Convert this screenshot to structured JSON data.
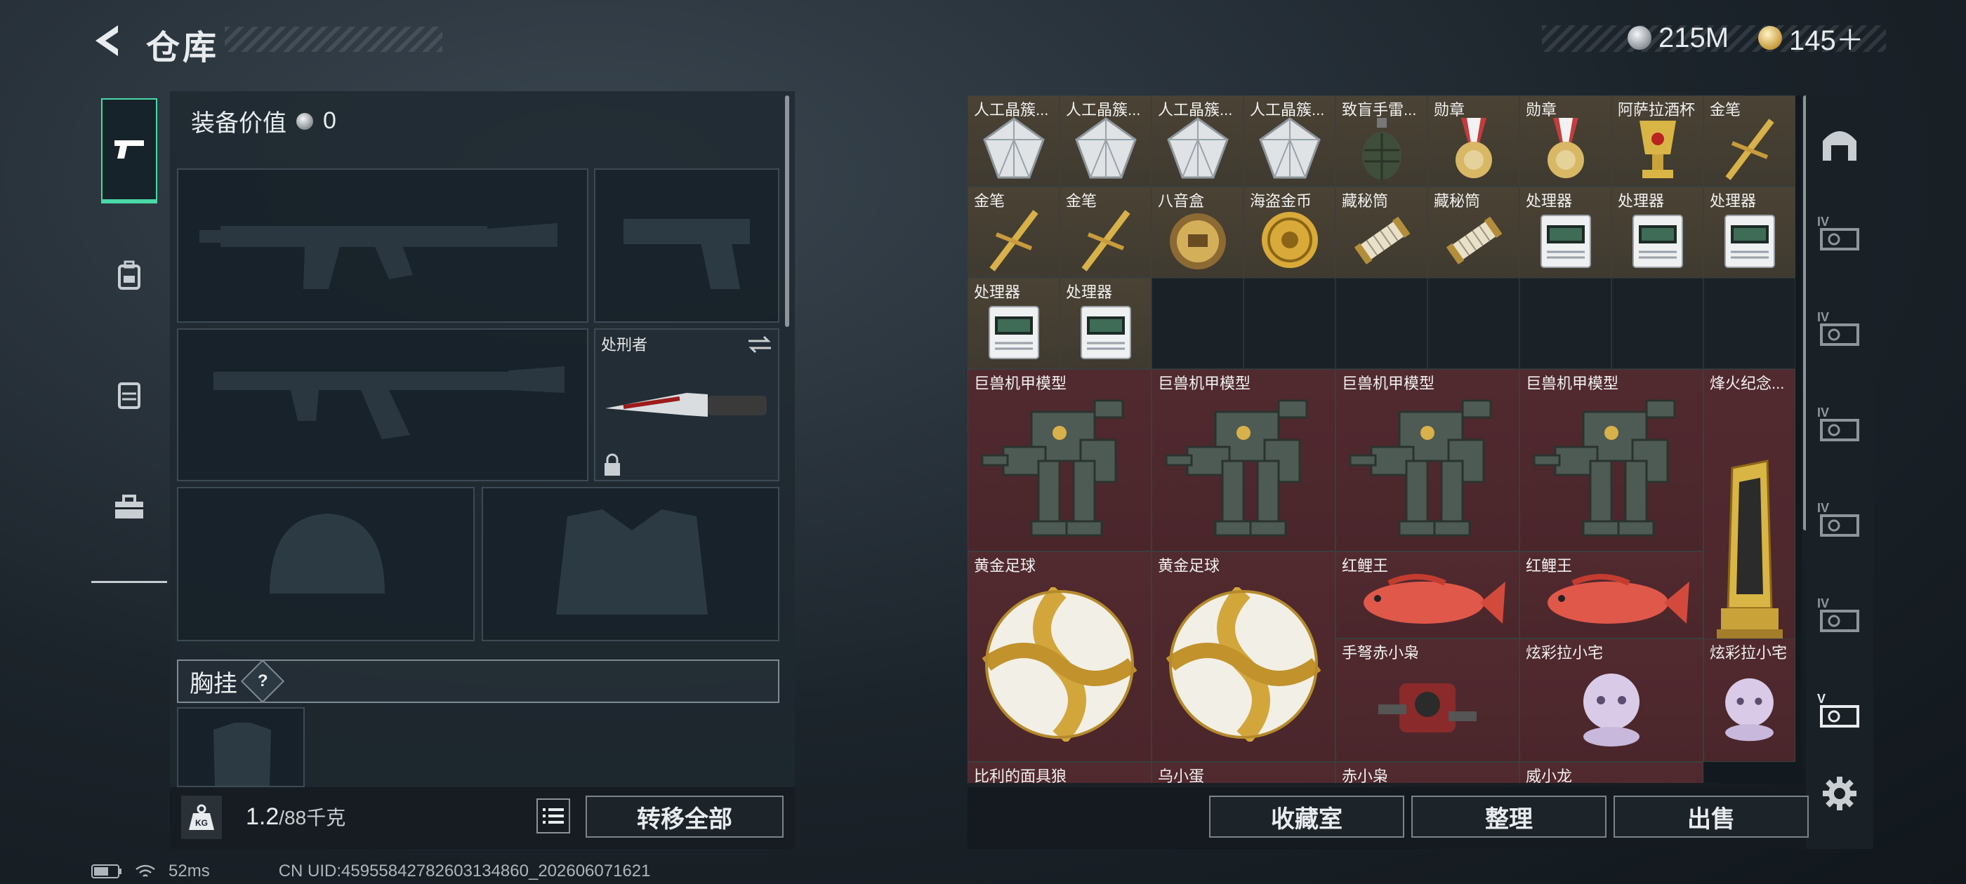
{
  "header": {
    "title": "仓库",
    "currency_primary": "215M",
    "currency_secondary": "145＋"
  },
  "side_tabs": [
    {
      "name": "pistol-icon",
      "active": true
    },
    {
      "name": "backpack-icon",
      "active": false
    },
    {
      "name": "vest-icon",
      "active": false
    },
    {
      "name": "toolbox-icon",
      "active": false
    }
  ],
  "equipment": {
    "value_label": "装备价值",
    "value": "0",
    "melee_slot_label": "处刑者",
    "chest_label": "胸挂",
    "help_symbol": "?"
  },
  "bottom_left": {
    "weight_value": "1.2",
    "weight_capacity": "/88千克",
    "transfer_all_label": "转移全部"
  },
  "status_bar": {
    "ping": "52ms",
    "uid": "CN UID:4595584278260313486​0_202606071621"
  },
  "warehouse": {
    "rows": [
      [
        {
          "name": "人工晶簇...",
          "rarity": "gold",
          "icon": "crystal"
        },
        {
          "name": "人工晶簇...",
          "rarity": "gold",
          "icon": "crystal"
        },
        {
          "name": "人工晶簇...",
          "rarity": "gold",
          "icon": "crystal"
        },
        {
          "name": "人工晶簇...",
          "rarity": "gold",
          "icon": "crystal"
        },
        {
          "name": "致盲手雷...",
          "rarity": "gold",
          "icon": "grenade"
        },
        {
          "name": "勋章",
          "rarity": "gold",
          "icon": "medal"
        },
        {
          "name": "勋章",
          "rarity": "gold",
          "icon": "medal"
        },
        {
          "name": "阿萨拉酒杯",
          "rarity": "gold",
          "icon": "goblet"
        },
        {
          "name": "金笔",
          "rarity": "gold",
          "icon": "pen"
        }
      ],
      [
        {
          "name": "金笔",
          "rarity": "gold",
          "icon": "pen"
        },
        {
          "name": "金笔",
          "rarity": "gold",
          "icon": "pen"
        },
        {
          "name": "八音盒",
          "rarity": "gold",
          "icon": "musicbox"
        },
        {
          "name": "海盗金币",
          "rarity": "gold",
          "icon": "coin"
        },
        {
          "name": "藏秘筒",
          "rarity": "gold",
          "icon": "cryptex"
        },
        {
          "name": "藏秘筒",
          "rarity": "gold",
          "icon": "cryptex"
        },
        {
          "name": "处理器",
          "rarity": "gold",
          "icon": "processor"
        },
        {
          "name": "处理器",
          "rarity": "gold",
          "icon": "processor"
        },
        {
          "name": "处理器",
          "rarity": "gold",
          "icon": "processor"
        }
      ],
      [
        {
          "name": "处理器",
          "rarity": "gold",
          "icon": "processor"
        },
        {
          "name": "处理器",
          "rarity": "gold",
          "icon": "processor"
        }
      ]
    ],
    "big_items": [
      {
        "name": "巨兽机甲模型",
        "rarity": "red",
        "icon": "mech"
      },
      {
        "name": "巨兽机甲模型",
        "rarity": "red",
        "icon": "mech"
      },
      {
        "name": "巨兽机甲模型",
        "rarity": "red",
        "icon": "mech"
      },
      {
        "name": "巨兽机甲模型",
        "rarity": "red",
        "icon": "mech"
      },
      {
        "name": "烽火纪念...",
        "rarity": "red",
        "icon": "trophy"
      },
      {
        "name": "黄金足球",
        "rarity": "red",
        "icon": "ball"
      },
      {
        "name": "黄金足球",
        "rarity": "red",
        "icon": "ball"
      },
      {
        "name": "红鲤王",
        "rarity": "red",
        "icon": "fish"
      },
      {
        "name": "红鲤王",
        "rarity": "red",
        "icon": "fish"
      },
      {
        "name": "手弩赤小枭",
        "rarity": "red",
        "icon": "robot"
      },
      {
        "name": "炫彩拉小宅",
        "rarity": "red",
        "icon": "plush"
      },
      {
        "name": "炫彩拉小宅",
        "rarity": "red",
        "icon": "plush"
      },
      {
        "name": "比利的面具狼",
        "rarity": "red",
        "icon": "mask"
      },
      {
        "name": "乌小蛋",
        "rarity": "red",
        "icon": "egg"
      },
      {
        "name": "赤小枭",
        "rarity": "red",
        "icon": "robot"
      },
      {
        "name": "威小龙",
        "rarity": "red",
        "icon": "robot"
      }
    ]
  },
  "right_rail": [
    {
      "name": "home-icon"
    },
    {
      "name": "storage-iv-1-icon",
      "label": "IV"
    },
    {
      "name": "storage-iv-2-icon",
      "label": "IV"
    },
    {
      "name": "storage-iv-3-icon",
      "label": "IV"
    },
    {
      "name": "storage-iv-4-icon",
      "label": "IV"
    },
    {
      "name": "storage-iv-5-icon",
      "label": "IV"
    },
    {
      "name": "storage-v-icon",
      "label": "V"
    },
    {
      "name": "settings-gear-icon"
    }
  ],
  "bottom_right": {
    "collection_label": "收藏室",
    "organize_label": "整理",
    "sell_label": "出售"
  },
  "colors": {
    "accent": "#4ad8a7",
    "gold_rarity": "#4a4234",
    "red_rarity": "#512a2f"
  }
}
